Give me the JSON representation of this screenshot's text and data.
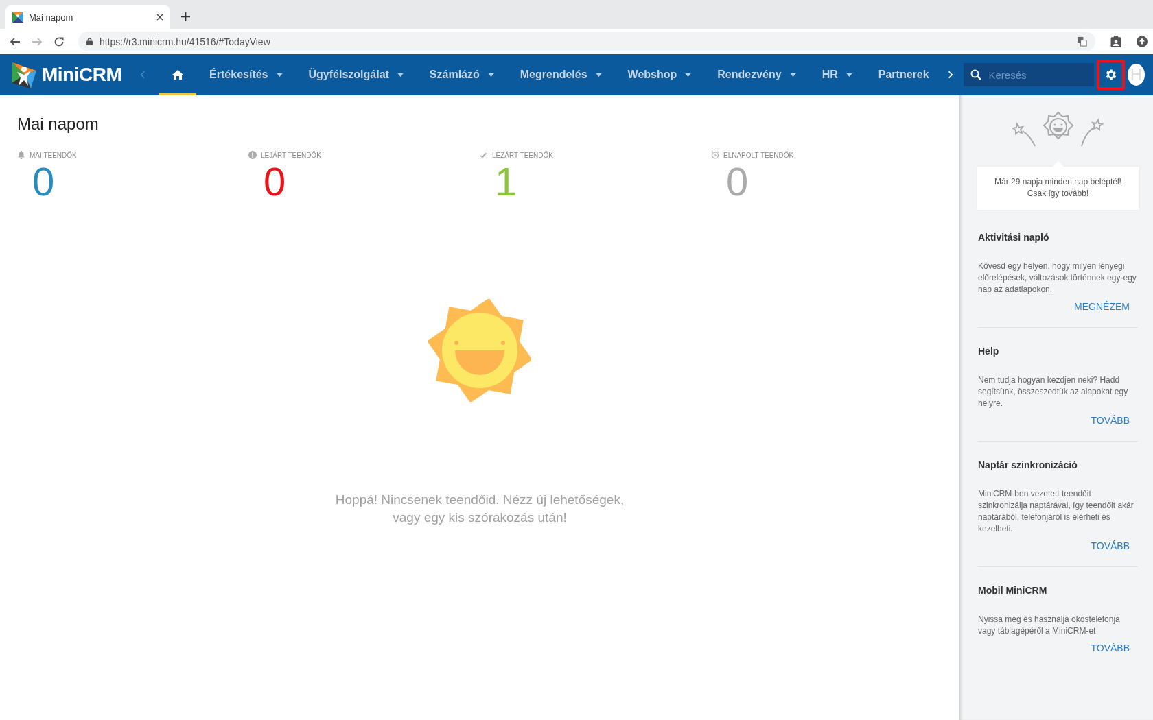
{
  "browser": {
    "tab": {
      "title": "Mai napom"
    },
    "url": "https://r3.minicrm.hu/41516/#TodayView"
  },
  "nav": {
    "logo": "MiniCRM",
    "items": [
      {
        "kind": "home",
        "selected": true
      },
      {
        "kind": "text",
        "label": "Értékesítés",
        "dropdown": true,
        "selected": false
      },
      {
        "kind": "text",
        "label": "Ügyfélszolgálat",
        "dropdown": true,
        "selected": false
      },
      {
        "kind": "text",
        "label": "Számlázó",
        "dropdown": true,
        "selected": false
      },
      {
        "kind": "text",
        "label": "Megrendelés",
        "dropdown": true,
        "selected": false
      },
      {
        "kind": "text",
        "label": "Webshop",
        "dropdown": true,
        "selected": false
      },
      {
        "kind": "text",
        "label": "Rendezvény",
        "dropdown": true,
        "selected": false
      },
      {
        "kind": "text",
        "label": "HR",
        "dropdown": true,
        "selected": false
      },
      {
        "kind": "text",
        "label": "Partnerek",
        "dropdown": false,
        "selected": false
      }
    ],
    "search": {
      "placeholder": "Keresés"
    },
    "settings": {
      "highlighted": true
    },
    "avatar": "H"
  },
  "page": {
    "title": "Mai napom",
    "stats": [
      {
        "label": "MAI TEENDŐK",
        "value": "0",
        "color": "#2a8bc0"
      },
      {
        "label": "LEJÁRT TEENDŐK",
        "value": "0",
        "color": "#e8141c"
      },
      {
        "label": "LEZÁRT TEENDŐK",
        "value": "1",
        "color": "#8cc43c"
      },
      {
        "label": "ELNAPOLT TEENDŐK",
        "value": "0",
        "color": "#aaaaaa"
      }
    ],
    "empty_message": "Hoppá! Nincsenek teendőid. Nézz új lehetőségek, vagy egy kis szórakozás után!"
  },
  "sidebar": {
    "streak": "Már 29 napja minden nap beléptél! Csak így tovább!",
    "sections": [
      {
        "title": "Aktivitási napló",
        "text": "Kövesd egy helyen, hogy milyen lényegi előrelépések, változások történnek egy-egy nap az adatlapokon.",
        "link": "MEGNÉZEM"
      },
      {
        "title": "Help",
        "text": "Nem tudja hogyan kezdjen neki? Hadd segítsünk, összeszedtük az alapokat egy helyre.",
        "link": "TOVÁBB"
      },
      {
        "title": "Naptár szinkronizáció",
        "text": "MiniCRM-ben vezetett teendőit szinkronizálja naptárával, így teendőit akár naptárából, telefonjáról is elérheti és kezelheti.",
        "link": "TOVÁBB"
      },
      {
        "title": "Mobil MiniCRM",
        "text": "Nyissa meg és használja okostelefonja vagy táblagépéről a MiniCRM-et",
        "link": "TOVÁBB"
      }
    ]
  }
}
